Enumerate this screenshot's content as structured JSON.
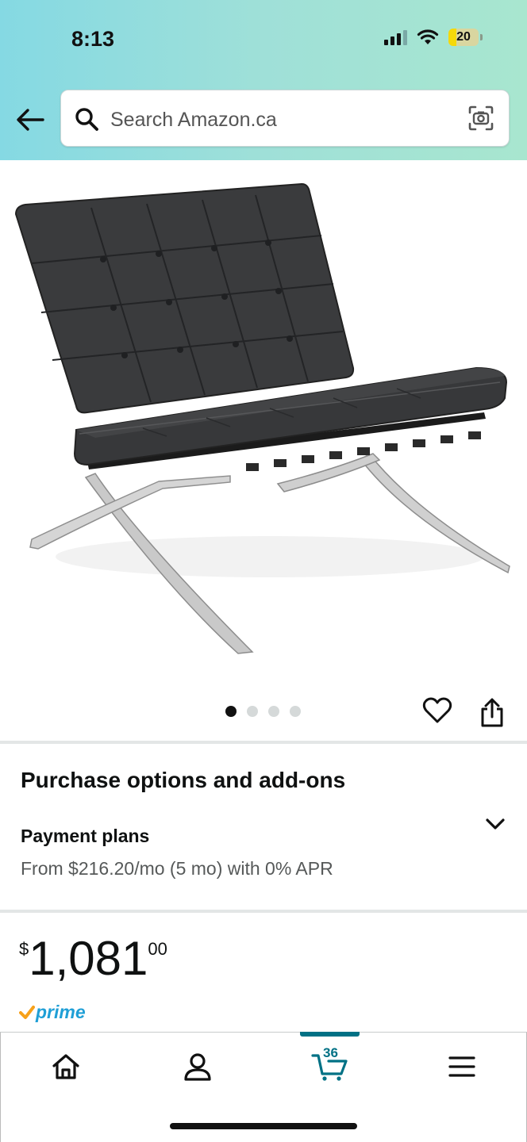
{
  "status_bar": {
    "time": "8:13",
    "battery": "20"
  },
  "header": {
    "search_placeholder": "Search Amazon.ca"
  },
  "gallery": {
    "image_count": 4,
    "active_index": 0
  },
  "purchase": {
    "title": "Purchase options and add-ons",
    "payment_title": "Payment plans",
    "payment_sub": "From $216.20/mo (5 mo) with 0% APR"
  },
  "price": {
    "currency": "$",
    "whole": "1,081",
    "fraction": "00"
  },
  "prime": {
    "label": "prime"
  },
  "bottom_nav": {
    "cart_count": "36"
  },
  "colors": {
    "header_gradient_start": "#85d9e3",
    "header_gradient_end": "#a8e6cf",
    "teal_accent": "#007185",
    "prime_blue": "#1f9fd6",
    "prime_check": "#f7a11a"
  }
}
